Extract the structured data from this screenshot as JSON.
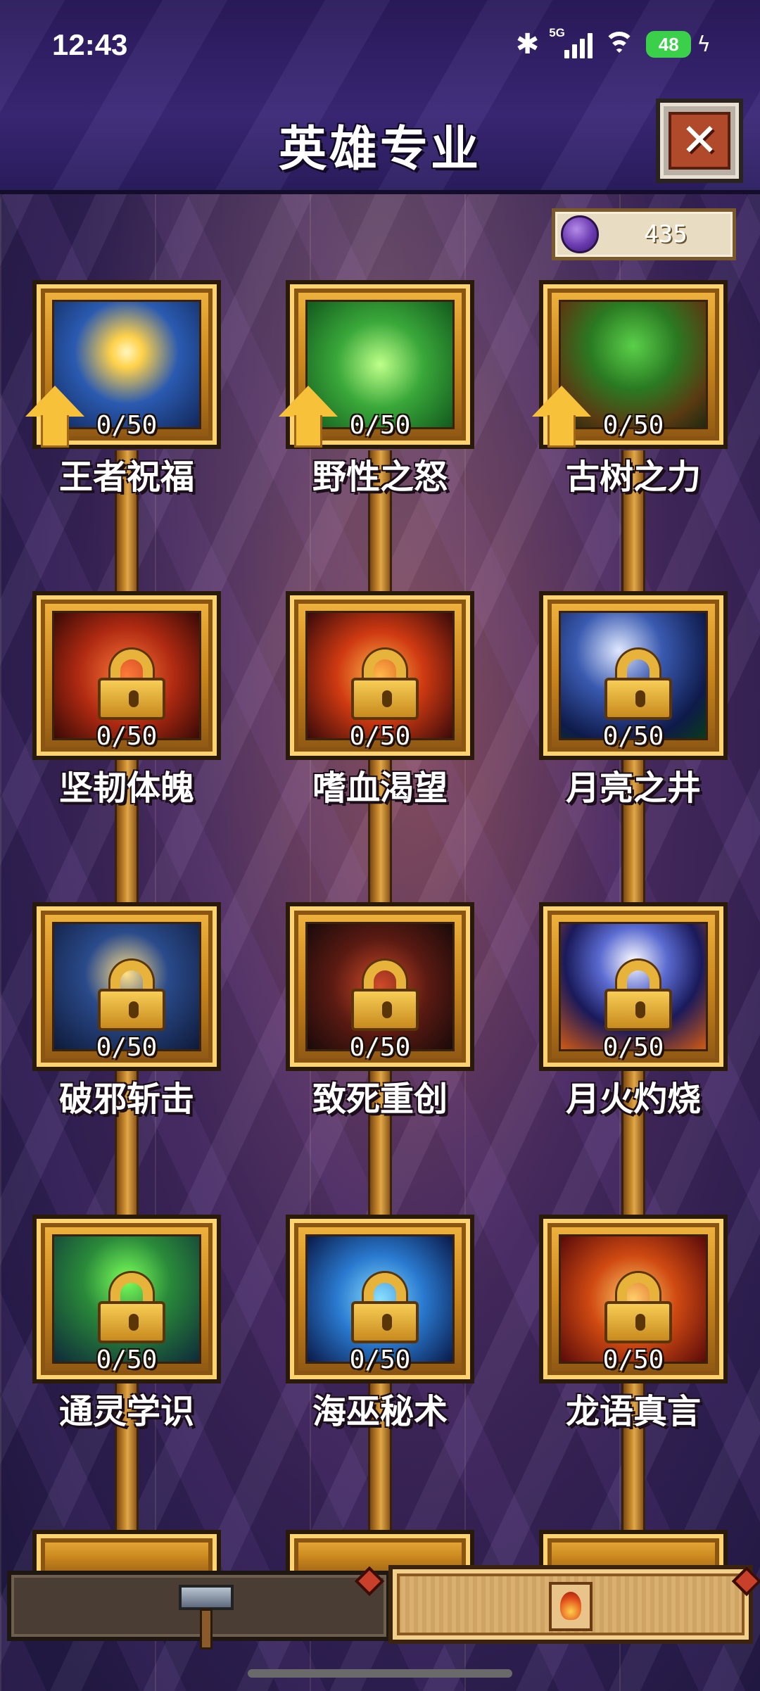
{
  "status_bar": {
    "time": "12:43",
    "network": "5G",
    "battery": "48"
  },
  "header": {
    "title": "英雄专业"
  },
  "currency": {
    "value": "435",
    "icon": "purple-gem-icon"
  },
  "skills": [
    {
      "name": "王者祝福",
      "level": "0/50",
      "locked": false,
      "upgradable": true
    },
    {
      "name": "野性之怒",
      "level": "0/50",
      "locked": false,
      "upgradable": true
    },
    {
      "name": "古树之力",
      "level": "0/50",
      "locked": false,
      "upgradable": true
    },
    {
      "name": "坚韧体魄",
      "level": "0/50",
      "locked": true
    },
    {
      "name": "嗜血渴望",
      "level": "0/50",
      "locked": true
    },
    {
      "name": "月亮之井",
      "level": "0/50",
      "locked": true
    },
    {
      "name": "破邪斩击",
      "level": "0/50",
      "locked": true
    },
    {
      "name": "致死重创",
      "level": "0/50",
      "locked": true
    },
    {
      "name": "月火灼烧",
      "level": "0/50",
      "locked": true
    },
    {
      "name": "通灵学识",
      "level": "0/50",
      "locked": true
    },
    {
      "name": "海巫秘术",
      "level": "0/50",
      "locked": true
    },
    {
      "name": "龙语真言",
      "level": "0/50",
      "locked": true
    }
  ],
  "bottom_nav": {
    "left_icon": "hammer-icon",
    "right_icon": "scroll-icon",
    "active": "right"
  }
}
